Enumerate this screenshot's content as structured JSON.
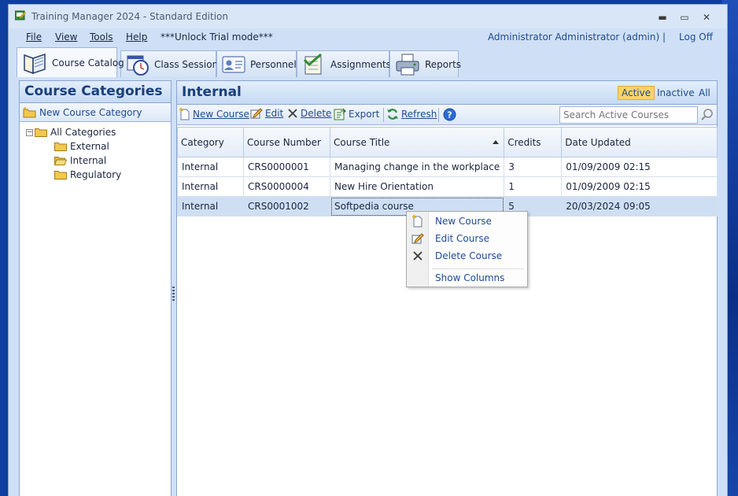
{
  "window": {
    "title": "Training Manager 2024 - Standard Edition",
    "controls": {
      "minimize": "▬",
      "maximize": "▭",
      "close": "✕"
    }
  },
  "menu": {
    "items": [
      "File",
      "View",
      "Tools",
      "Help"
    ],
    "trial": "***Unlock Trial mode***",
    "user": "Administrator Administrator (admin)  |",
    "logoff": "Log Off"
  },
  "tabs": [
    {
      "label": "Course Catalog",
      "icon": "book-icon"
    },
    {
      "label": "Class Sessions",
      "icon": "calendar-clock-icon"
    },
    {
      "label": "Personnel",
      "icon": "id-card-icon"
    },
    {
      "label": "Assignments",
      "icon": "checklist-icon"
    },
    {
      "label": "Reports",
      "icon": "printer-icon"
    }
  ],
  "left": {
    "title": "Course Categories",
    "new_category": "New Course Category",
    "tree": {
      "root": "All Categories",
      "children": [
        "External",
        "Internal",
        "Regulatory"
      ],
      "expander": "−"
    }
  },
  "right": {
    "title": "Internal",
    "filters": [
      "Active",
      "Inactive",
      "All"
    ],
    "toolbar": {
      "new": "New Course",
      "edit": "Edit",
      "delete": "Delete",
      "export": "Export",
      "refresh": "Refresh"
    },
    "search_placeholder": "Search Active Courses",
    "columns": [
      "Category",
      "Course Number",
      "Course Title",
      "Credits",
      "Date Updated"
    ],
    "rows": [
      [
        "Internal",
        "CRS0000001",
        "Managing change in the workplace",
        "3",
        "01/09/2009 02:15"
      ],
      [
        "Internal",
        "CRS0000004",
        "New Hire Orientation",
        "1",
        "01/09/2009 02:15"
      ],
      [
        "Internal",
        "CRS0001002",
        "Softpedia course",
        "5",
        "20/03/2024 09:05"
      ]
    ]
  },
  "context_menu": {
    "items": [
      "New Course",
      "Edit Course",
      "Delete Course",
      "Show Columns"
    ]
  },
  "colors": {
    "accent": "#1f4a92",
    "active_filter": "#ffd36b",
    "selected_row": "#cfdff3"
  }
}
